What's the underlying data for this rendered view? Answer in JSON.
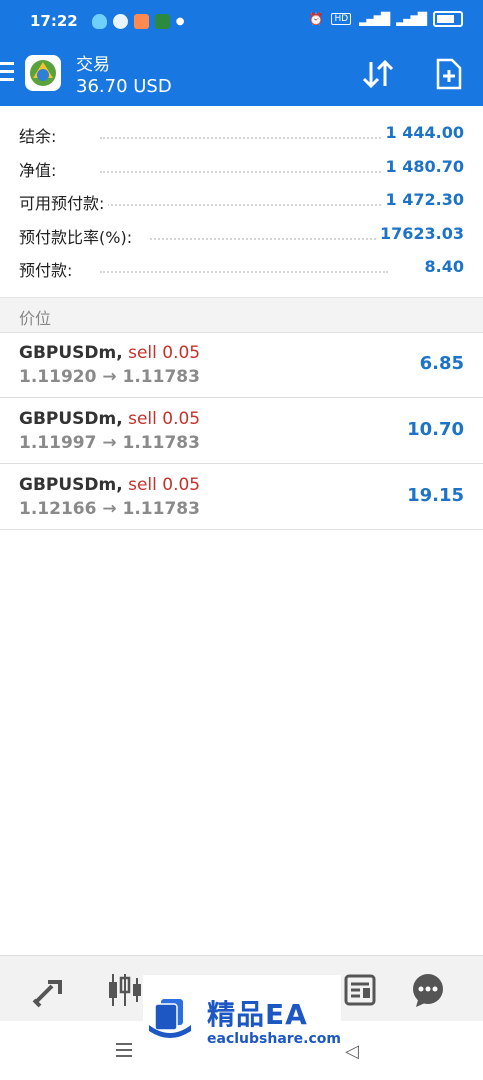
{
  "status_bar": {
    "time": "17:22"
  },
  "header": {
    "title": "交易",
    "subtitle": "36.70 USD"
  },
  "account": [
    {
      "label": "结余:",
      "value": "1 444.00"
    },
    {
      "label": "净值:",
      "value": "1 480.70"
    },
    {
      "label": "可用预付款:",
      "value": "1 472.30"
    },
    {
      "label": "预付款比率(%):",
      "value": "17623.03"
    },
    {
      "label": "预付款:",
      "value": "8.40"
    }
  ],
  "section": {
    "label": "价位"
  },
  "positions": [
    {
      "symbol": "GBPUSDm,",
      "side": "sell 0.05",
      "prices": "1.11920 → 1.11783",
      "profit": "6.85"
    },
    {
      "symbol": "GBPUSDm,",
      "side": "sell 0.05",
      "prices": "1.11997 → 1.11783",
      "profit": "10.70"
    },
    {
      "symbol": "GBPUSDm,",
      "side": "sell 0.05",
      "prices": "1.12166 → 1.11783",
      "profit": "19.15"
    }
  ],
  "bottom_nav": [
    "quotes-icon",
    "chart-icon",
    "trade-icon",
    "history-icon",
    "news-icon",
    "chat-icon"
  ],
  "watermark": {
    "title": "精品EA",
    "url": "eaclubshare.com"
  },
  "colors": {
    "brand": "#1977e1",
    "value": "#1c73c8",
    "sell": "#c6322b"
  }
}
